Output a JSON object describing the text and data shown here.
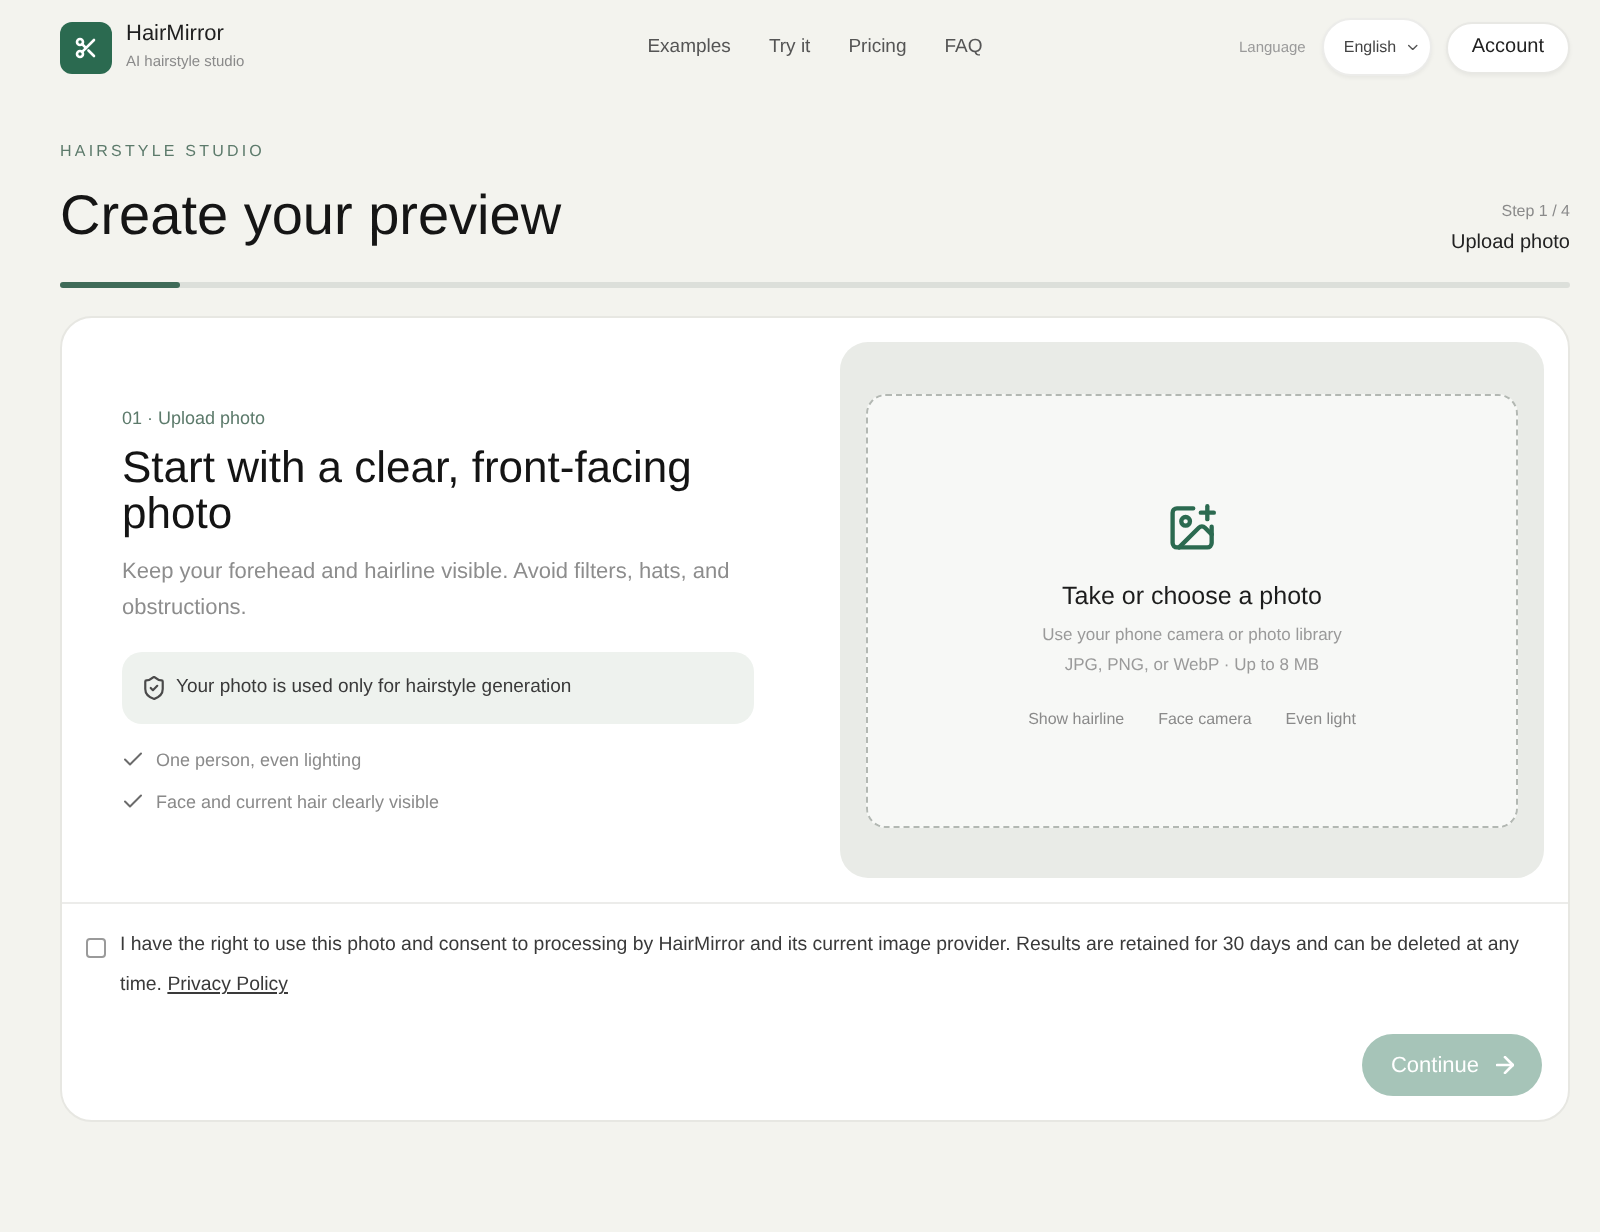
{
  "header": {
    "brand": {
      "name": "HairMirror",
      "tagline": "AI hairstyle studio"
    },
    "nav": [
      "Examples",
      "Try it",
      "Pricing",
      "FAQ"
    ],
    "language": {
      "label": "Language",
      "value": "English"
    },
    "account_button": "Account"
  },
  "page": {
    "eyebrow": "HAIRSTYLE STUDIO",
    "title": "Create your preview",
    "step": "Step 1 / 4",
    "step_name": "Upload photo",
    "progress": {
      "level": 0.08
    }
  },
  "intro": {
    "step_label": "01 · Upload photo",
    "heading": "Start with a clear, front-facing photo",
    "description": "Keep your forehead and hairline visible. Avoid filters, hats, and obstructions.",
    "privacy_note": "Your photo is used only for hairstyle generation",
    "checklist": [
      "One person, even lighting",
      "Face and current hair clearly visible"
    ]
  },
  "upload": {
    "title": "Take or choose a photo",
    "hint": "Use your phone camera or photo library",
    "formats": "JPG, PNG, or WebP · Up to 8 MB",
    "tips": [
      "Show hairline",
      "Face camera",
      "Even light"
    ]
  },
  "consent": {
    "checked": false,
    "text": "I have the right to use this photo and consent to processing by HairMirror and its current image provider. Results are retained for 30 days and can be deleted at any time.",
    "link": "Privacy Policy"
  },
  "continue_button": {
    "label": "Continue",
    "disabled": true
  }
}
